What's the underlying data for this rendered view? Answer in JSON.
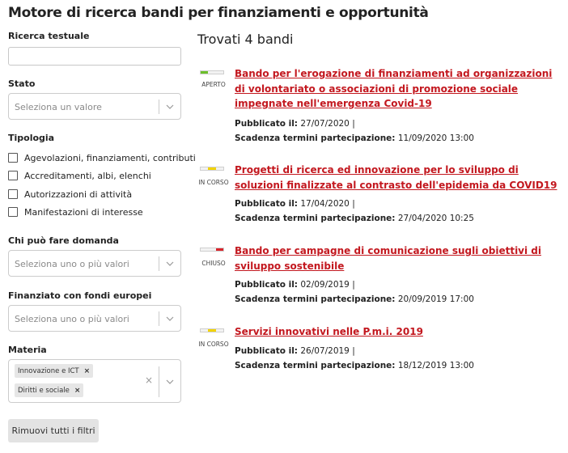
{
  "page": {
    "title": "Motore di ricerca bandi per finanziamenti e opportunità"
  },
  "filters": {
    "text_search": {
      "label": "Ricerca testuale",
      "value": ""
    },
    "stato": {
      "label": "Stato",
      "placeholder": "Seleziona un valore"
    },
    "tipologia": {
      "label": "Tipologia",
      "options": [
        {
          "label": "Agevolazioni, finanziamenti, contributi",
          "checked": false
        },
        {
          "label": "Accreditamenti, albi, elenchi",
          "checked": false
        },
        {
          "label": "Autorizzazioni di attività",
          "checked": false
        },
        {
          "label": "Manifestazioni di interesse",
          "checked": false
        }
      ]
    },
    "chi_puo": {
      "label": "Chi può fare domanda",
      "placeholder": "Seleziona uno o più valori"
    },
    "fondi_europei": {
      "label": "Finanziato con fondi europei",
      "placeholder": "Seleziona uno o più valori"
    },
    "materia": {
      "label": "Materia",
      "selected": [
        "Innovazione e ICT",
        "Diritti e sociale"
      ],
      "remove_symbol": "×",
      "clear_symbol": "×"
    },
    "reset_label": "Rimuovi tutti i filtri"
  },
  "results": {
    "title": "Trovati 4 bandi",
    "published_label": "Pubblicato il:",
    "deadline_label": "Scadenza termini partecipazione:",
    "items": [
      {
        "status": "APERTO",
        "status_color": "#6cbf2a",
        "status_fill": 0.33,
        "status_position": "left",
        "title": "Bando per l'erogazione di finanziamenti ad organizzazioni di volontariato o associazioni di promozione sociale impegnate nell'emergenza Covid-19",
        "published": "27/07/2020 |",
        "deadline": "11/09/2020 13:00"
      },
      {
        "status": "IN CORSO",
        "status_color": "#f2d300",
        "status_fill": 0.33,
        "status_position": "middle",
        "title": "Progetti di ricerca ed innovazione per lo sviluppo di soluzioni finalizzate al contrasto dell'epidemia da COVID19",
        "published": "17/04/2020 |",
        "deadline": "27/04/2020 10:25"
      },
      {
        "status": "CHIUSO",
        "status_color": "#d9242b",
        "status_fill": 0.33,
        "status_position": "right",
        "title": "Bando per campagne di comunicazione sugli obiettivi di sviluppo sostenibile",
        "published": "02/09/2019 |",
        "deadline": "20/09/2019 17:00"
      },
      {
        "status": "IN CORSO",
        "status_color": "#f2d300",
        "status_fill": 0.33,
        "status_position": "middle",
        "title": "Servizi innovativi nelle P.m.i. 2019",
        "published": "26/07/2019 |",
        "deadline": "18/12/2019 13:00"
      }
    ]
  }
}
